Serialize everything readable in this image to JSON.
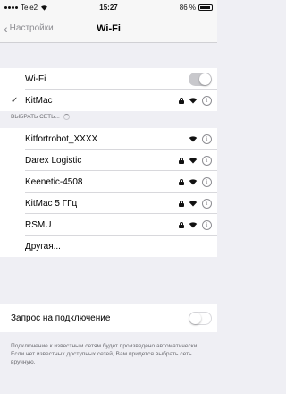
{
  "status": {
    "carrier": "Tele2",
    "time": "15:27",
    "battery": "86 %"
  },
  "nav": {
    "back_label": "Настройки",
    "title": "Wi-Fi"
  },
  "wifi": {
    "label": "Wi-Fi",
    "enabled": true,
    "connected_network": "KitMac"
  },
  "choose_header": "ВЫБРАТЬ СЕТЬ...",
  "networks": [
    {
      "name": "Kitfortrobot_XXXX",
      "locked": false
    },
    {
      "name": "Darex Logistic",
      "locked": true
    },
    {
      "name": "Keenetic-4508",
      "locked": true
    },
    {
      "name": "KitMac 5 ГГц",
      "locked": true
    },
    {
      "name": "RSMU",
      "locked": true
    }
  ],
  "other_label": "Другая...",
  "ask_to_join": {
    "label": "Запрос на подключение",
    "enabled": false
  },
  "footer": "Подключение к известным сетям будет произведено автоматически. Если нет известных доступных сетей, Вам придется выбрать сеть вручную.",
  "colors": {
    "background": "#efeff4",
    "accent_gray": "#8e8e93"
  }
}
